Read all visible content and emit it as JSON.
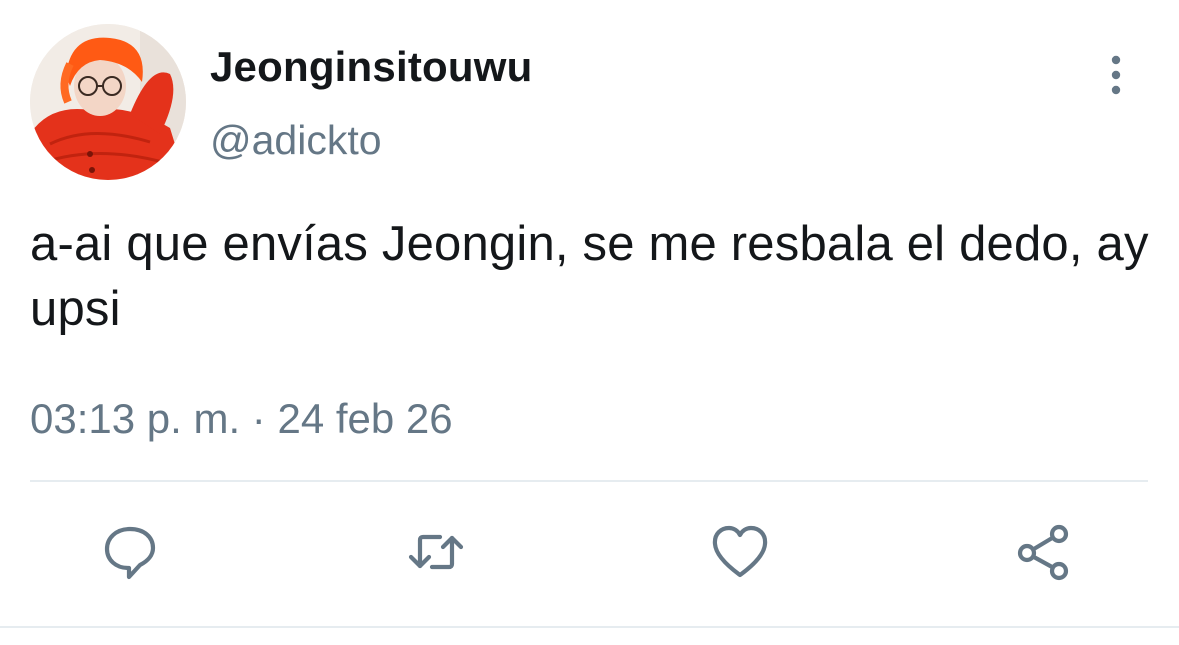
{
  "tweet": {
    "display_name": "Jeonginsitouwu",
    "handle": "@adickto",
    "text": "a-ai que envías Jeongin, se me resbala el dedo, ay upsi",
    "time": "03:13 p. m.",
    "separator": "·",
    "date": "24 feb 26"
  },
  "icons": {
    "more": "more-vertical-icon",
    "reply": "reply-icon",
    "retweet": "retweet-icon",
    "like": "heart-icon",
    "share": "share-icon"
  },
  "colors": {
    "text_primary": "#14171a",
    "text_secondary": "#657786",
    "divider": "#e6ecf0",
    "avatar_accent": "#e8331a"
  }
}
